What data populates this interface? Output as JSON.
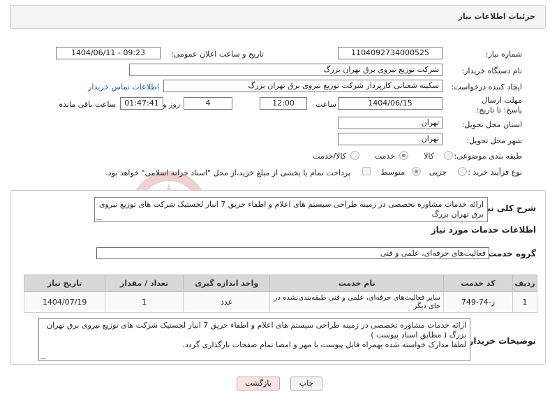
{
  "header": {
    "title": "جزئیات اطلاعات نیاز"
  },
  "fields": {
    "need_number_label": "شماره نیاز:",
    "need_number": "1104092734000525",
    "announce_label": "تاریخ و ساعت اعلان عمومی:",
    "announce_value": "1404/06/11 - 09:23",
    "buyer_org_label": "نام دستگاه خریدار:",
    "buyer_org": "شرکت توزیع نیروی برق تهران بزرگ",
    "creator_label": "ایجاد کننده درخواست:",
    "creator": "سکینه شعبانی کارپرداز شرکت توزیع نیروی برق تهران بزرگ",
    "contact_link": "اطلاعات تماس خریدار",
    "deadline_label": "مهلت ارسال پاسخ: تا تاریخ:",
    "deadline_date": "1404/06/15",
    "time_label": "ساعت",
    "deadline_time": "12:00",
    "days_value": "4",
    "days_label": "روز و",
    "remaining_time": "01:47:41",
    "remaining_label": "ساعت باقی مانده",
    "province_label": "استان محل تحویل:",
    "province": "تهران",
    "city_label": "شهر محل تحویل:",
    "city": "تهران",
    "category_label": "طبقه بندی موضوعی:",
    "category_options": [
      "کالا",
      "خدمت",
      "کالا/خدمت"
    ],
    "process_label": "نوع فرآیند خرید :",
    "process_options": [
      "جزیی",
      "متوسط"
    ],
    "payment_note": "پرداخت تمام یا بخشی از مبلغ خرید،از محل \"اسناد خزانه اسلامی\" خواهد بود."
  },
  "summary": {
    "label": "شرح کلی نیاز:",
    "text": "ارائه خدمات مشاوره تخصصی در زمینه طراحی سیستم های اعلام و اطفاء حریق 7 انبار لجستیک شرکت های توزیع نیروی برق تهران بزرگ"
  },
  "services": {
    "heading": "اطلاعات خدمات مورد نیاز",
    "group_label": "گروه خدمت:",
    "group_value": "فعالیت‌های حرفه‌ای، علمی و فنی",
    "columns": [
      "ردیف",
      "کد خدمت",
      "نام خدمت",
      "واحد اندازه گیری",
      "تعداد / مقدار",
      "تاریخ نیاز"
    ],
    "rows": [
      [
        "1",
        "ز-74-749",
        "سایر فعالیت‌های حرفه‌ای، علمی و فنی طبقه‌بندی‌نشده در جای دیگر",
        "عدد",
        "1",
        "1404/07/19"
      ]
    ]
  },
  "buyer_notes": {
    "label": "توضیحات خریدار:",
    "line1": "ارائه خدمات مشاوره تخصصی در زمینه طراحی سیستم های اعلام و اطفاء حریق 7 انبار لجستیک شرکت های توزیع نیروی برق تهران بزرگ ( مطابق اسناد پیوست )",
    "line2": "لطفا مدارک خواسته شده بهمراه فایل پیوست با مهر و امضا تمام صفحات بارگذاری گردد."
  },
  "buttons": {
    "print": "چاپ",
    "back": "بازگشت"
  },
  "watermark": "AriaTender.net",
  "colors": {
    "link": "#1a5fb4",
    "watermark": "#e9b4b4",
    "back_bg": "#fbe3e3"
  }
}
